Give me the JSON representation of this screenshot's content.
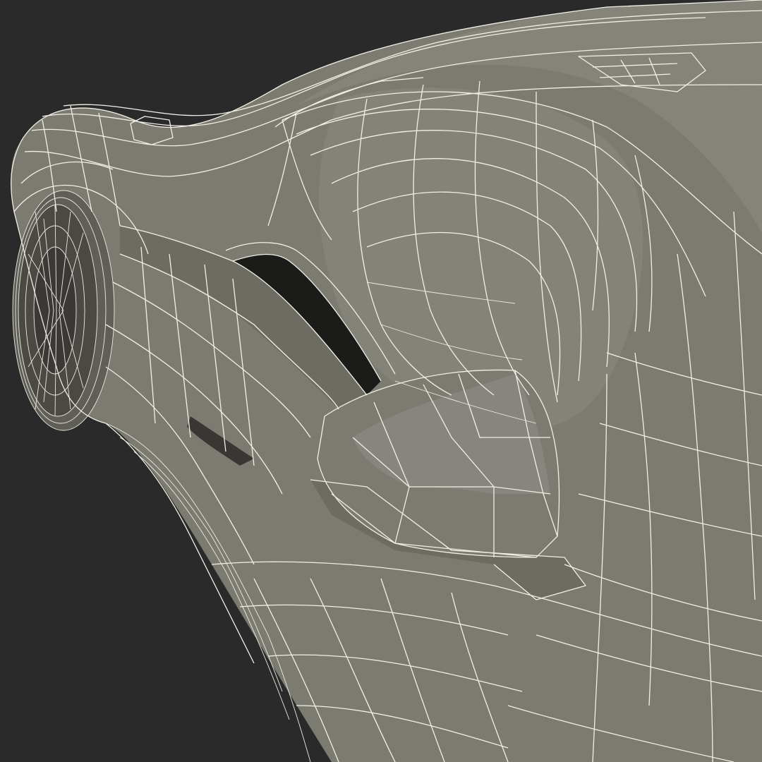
{
  "scene": {
    "subject": "wireframe-car-render",
    "colors": {
      "background": "#2a2a2a",
      "surface": "#7c7b72",
      "surface_dark": "#6d6c63",
      "surface_light": "#8b8a81",
      "wireframe": "#f2f0e6",
      "cavity": "#1b1b1a"
    }
  }
}
